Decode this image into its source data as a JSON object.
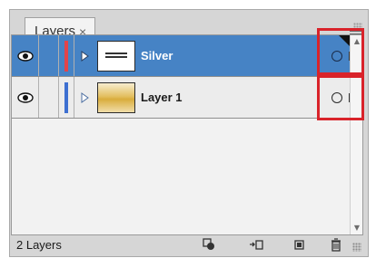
{
  "panel": {
    "tab_label": "Layers",
    "close_glyph": "×",
    "menu_icon": "panel-menu-icon"
  },
  "layers": [
    {
      "name": "Silver",
      "selected": true,
      "visible": true,
      "layer_color": "#e4444a",
      "thumbnail": "silver-logo-thumbnail",
      "target_icon": "target-circle-icon",
      "selection_color": "#e4444a",
      "has_selection_corner": true
    },
    {
      "name": "Layer 1",
      "selected": false,
      "visible": true,
      "layer_color": "#3d6fd1",
      "thumbnail": "gold-gradient-thumbnail",
      "target_icon": "target-circle-icon",
      "selection_color": "#3d6fd1",
      "has_selection_corner": false
    }
  ],
  "footer": {
    "count_label": "2 Layers",
    "buttons": [
      "make-clipping-mask-icon",
      "create-sublayer-icon",
      "create-new-layer-icon",
      "delete-layer-icon"
    ]
  },
  "colors": {
    "selected_row": "#4683c5",
    "highlight_box": "#d9232a"
  }
}
